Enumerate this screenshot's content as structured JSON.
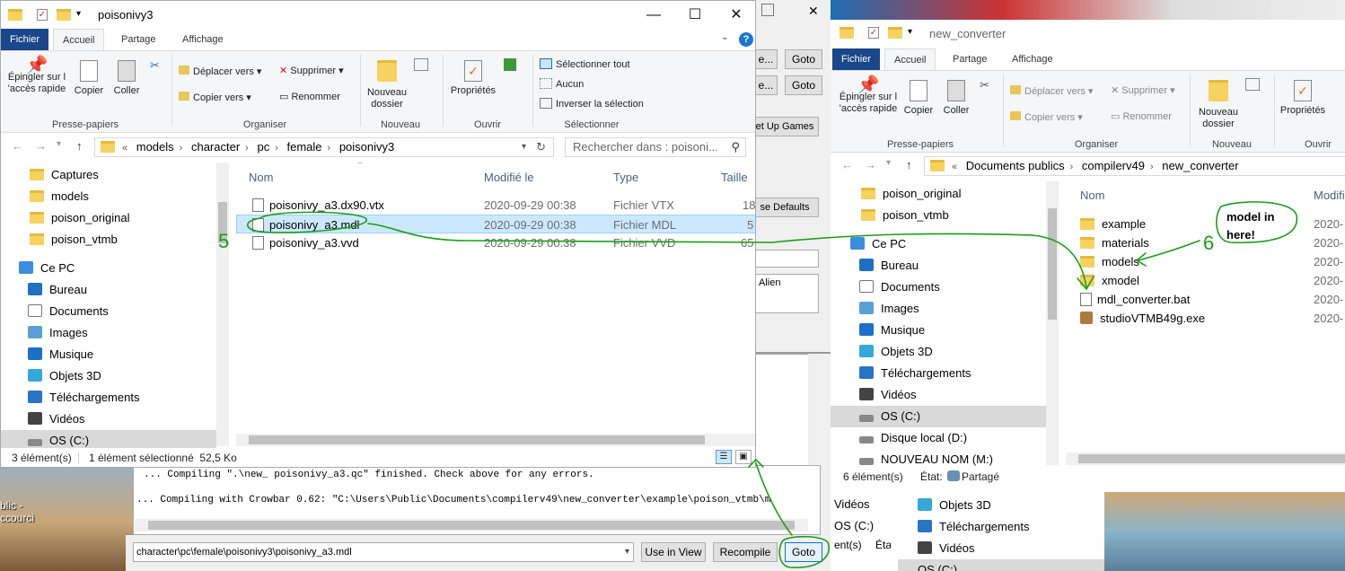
{
  "colors": {
    "accent_blue": "#19478a",
    "selection": "#cce8ff",
    "annotation_green": "#1a9e1a",
    "folder_yellow": "#f6d25f"
  },
  "left_window": {
    "title": "poisonivy3",
    "tabs": [
      "Fichier",
      "Accueil",
      "Partage",
      "Affichage"
    ],
    "ribbon": {
      "pin": "Épingler sur l 'accès rapide",
      "copy": "Copier",
      "paste": "Coller",
      "move_to": "Déplacer vers",
      "copy_to": "Copier vers",
      "delete": "Supprimer",
      "rename": "Renommer",
      "new_folder": "Nouveau dossier",
      "properties": "Propriétés",
      "select_all": "Sélectionner tout",
      "select_none": "Aucun",
      "invert": "Inverser la sélection",
      "groups": [
        "Presse-papiers",
        "Organiser",
        "Nouveau",
        "Ouvrir",
        "Sélectionner"
      ]
    },
    "address": [
      "models",
      "character",
      "pc",
      "female",
      "poisonivy3"
    ],
    "search_placeholder": "Rechercher dans : poisoni...",
    "tree": [
      "Captures",
      "models",
      "poison_original",
      "poison_vtmb",
      "Ce PC",
      "Bureau",
      "Documents",
      "Images",
      "Musique",
      "Objets 3D",
      "Téléchargements",
      "Vidéos",
      "OS (C:)"
    ],
    "columns": {
      "name": "Nom",
      "modified": "Modifié le",
      "type": "Type",
      "size": "Taille"
    },
    "files": [
      {
        "name": "poisonivy_a3.dx90.vtx",
        "modified": "2020-09-29 00:38",
        "type": "Fichier VTX",
        "size": "18"
      },
      {
        "name": "poisonivy_a3.mdl",
        "modified": "2020-09-29 00:38",
        "type": "Fichier MDL",
        "size": "5"
      },
      {
        "name": "poisonivy_a3.vvd",
        "modified": "2020-09-29 00:38",
        "type": "Fichier VVD",
        "size": "65"
      }
    ],
    "status": {
      "count": "3 élément(s)",
      "selected": "1 élément sélectionné  52,5 Ko"
    }
  },
  "right_window": {
    "title": "new_converter",
    "tabs": [
      "Fichier",
      "Accueil",
      "Partage",
      "Affichage"
    ],
    "ribbon": {
      "pin": "Épingler sur l 'accès rapide",
      "copy": "Copier",
      "paste": "Coller",
      "move_to": "Déplacer vers",
      "copy_to": "Copier vers",
      "delete": "Supprimer",
      "rename": "Renommer",
      "new_folder": "Nouveau dossier",
      "properties": "Propriétés",
      "groups": [
        "Presse-papiers",
        "Organiser",
        "Nouveau",
        "Ouvrir"
      ]
    },
    "address": [
      "Documents publics",
      "compilerv49",
      "new_converter"
    ],
    "tree": [
      "poison_original",
      "poison_vtmb",
      "Ce PC",
      "Bureau",
      "Documents",
      "Images",
      "Musique",
      "Objets 3D",
      "Téléchargements",
      "Vidéos",
      "OS (C:)",
      "Disque local (D:)",
      "NOUVEAU NOM (M:)"
    ],
    "columns": {
      "name": "Nom",
      "modified": "Modifi"
    },
    "files": [
      {
        "name": "example",
        "modified": "2020-"
      },
      {
        "name": "materials",
        "modified": "2020-"
      },
      {
        "name": "models",
        "modified": "2020-"
      },
      {
        "name": "xmodel",
        "modified": "2020-"
      },
      {
        "name": "mdl_converter.bat",
        "modified": "2020-"
      },
      {
        "name": "studioVTMB49g.exe",
        "modified": "2020-"
      }
    ],
    "status": {
      "count": "6 élément(s)",
      "state": "État:",
      "shared": "Partagé"
    }
  },
  "crowbar": {
    "goto": "Goto",
    "setup_games": "et Up Games",
    "use_defaults": "se Defaults",
    "alien": "Alien",
    "log1": "... Compiling \".\\new_ poisonivy_a3.qc\" finished. Check above for any errors.",
    "log2": "... Compiling with Crowbar 0.62: \"C:\\Users\\Public\\Documents\\compilerv49\\new_converter\\example\\poison_vtmb\\m",
    "path_value": "character\\pc\\female\\poisonivy3\\poisonivy_a3.mdl",
    "use_in_view": "Use in View",
    "recompile": "Recompile",
    "dots": "e..."
  },
  "background_window": {
    "tree": [
      "Vidéos",
      "OS (C:)"
    ],
    "status": "ent(s)",
    "sub_tree": [
      "Objets 3D",
      "Téléchargements",
      "Vidéos",
      "OS (C:)"
    ],
    "cut": "Éta"
  },
  "desktop": {
    "shortcut": "blic - ccourci"
  },
  "annotations": {
    "step5": "5",
    "step6": "6",
    "note": "model in here!"
  }
}
